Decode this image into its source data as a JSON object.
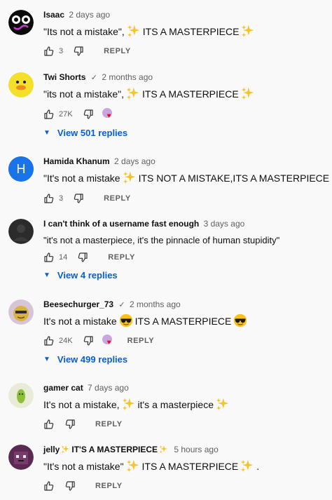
{
  "comments": [
    {
      "author": "Isaac",
      "time": "2 days ago",
      "text_before": "\"Its not a mistake\",",
      "text_after": "ITS A MASTERPIECE",
      "likes": "3",
      "reply_label": "REPLY",
      "avatar_color": "#0b0b0b"
    },
    {
      "author": "Twi Shorts",
      "verified_mark": "✓",
      "time": "2 months ago",
      "text_before": "\"its not a mistake\",",
      "text_after": "ITS A MASTERPIECE",
      "likes": "27K",
      "heart_mark": "♥",
      "view_replies": "View 501 replies",
      "avatar_color": "#f2e02a"
    },
    {
      "author": "Hamida Khanum",
      "time": "2 days ago",
      "text_before": "\"It's not a mistake",
      "text_after": "ITS NOT A MISTAKE,ITS A MASTERPIECE",
      "likes": "3",
      "reply_label": "REPLY",
      "avatar_letter": "H",
      "avatar_color": "#1a73e8"
    },
    {
      "author": "I can't think of a username fast enough",
      "time": "3 days ago",
      "text": "\"it's not a masterpiece, it's the pinnacle of human stupidity\"",
      "likes": "14",
      "reply_label": "REPLY",
      "view_replies": "View 4 replies",
      "avatar_color": "#2b2b2b"
    },
    {
      "author": "Beesechurger_73",
      "verified_mark": "✓",
      "time": "2 months ago",
      "text_before": "It's not a mistake",
      "text_after": "ITS A MASTERPIECE",
      "likes": "24K",
      "heart_mark": "♥",
      "reply_label": "REPLY",
      "view_replies": "View 499 replies",
      "avatar_color": "#d8b43a"
    },
    {
      "author": "gamer cat",
      "time": "7 days ago",
      "text_before": "It's not a mistake,",
      "text_after": "it's a masterpiece",
      "reply_label": "REPLY",
      "avatar_color": "#e8ecd6"
    },
    {
      "author_before": "jelly",
      "author_after": "IT'S A MASTERPIECE",
      "time": "5 hours ago",
      "text_before": "\"It's not a mistake\"",
      "text_after": "ITS A MASTERPIECE",
      "text_end": ".",
      "reply_label": "REPLY",
      "avatar_color": "#5b2a52"
    }
  ],
  "colors": {
    "background": "#f9f9f9",
    "link_blue": "#065fd4",
    "secondary_text": "#606060",
    "sparkle": "#f7c325"
  }
}
